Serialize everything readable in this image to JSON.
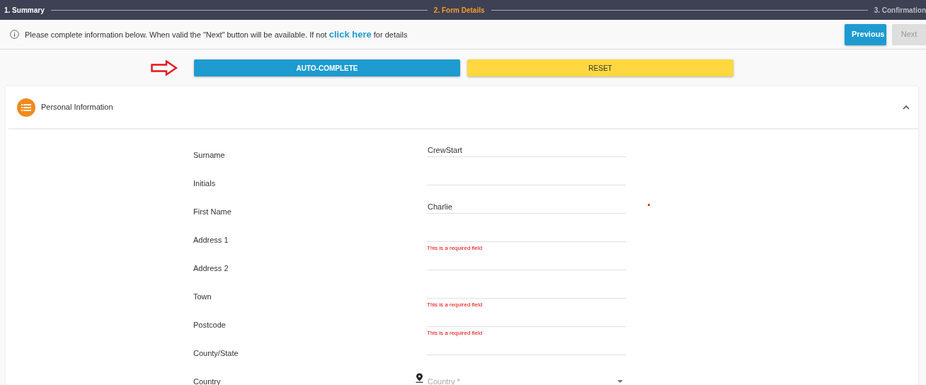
{
  "stepper": [
    {
      "label": "1. Summary",
      "selected": false,
      "completed": true
    },
    {
      "label": "2. Form Details",
      "selected": true
    },
    {
      "label": "3. Confirmation",
      "selected": false,
      "completed": false
    }
  ],
  "info_bar": {
    "message": "Please complete information below. When valid the \"Next\" button will be available. If not",
    "link": "click here",
    "message_end": "for details"
  },
  "nav_buttons": [
    {
      "label": "Previous",
      "disabled": false
    },
    {
      "label": "Next",
      "disabled": true
    }
  ],
  "actions": [
    {
      "label": "AUTO-COMPLETE",
      "kind": "primary"
    },
    {
      "label": "RESET",
      "kind": "warning"
    }
  ],
  "section": {
    "title": "Personal Information",
    "expanded": true,
    "fields": [
      {
        "label": "Surname",
        "kind": "text",
        "value": "CrewStart",
        "required": false
      },
      {
        "label": "Initials",
        "kind": "text",
        "required": false
      },
      {
        "label": "First Name",
        "kind": "text",
        "value": "Charlie",
        "required": true
      },
      {
        "label": "Address 1",
        "kind": "text",
        "error": "This is a required field",
        "required": false
      },
      {
        "label": "Address 2",
        "kind": "text",
        "required": false
      },
      {
        "label": "Town",
        "kind": "text",
        "error": "This is a required field",
        "required": false
      },
      {
        "label": "Postcode",
        "kind": "text",
        "error": "This is a required field",
        "required": false
      },
      {
        "label": "County/State",
        "kind": "text",
        "required": false
      },
      {
        "label": "Country",
        "kind": "select",
        "placeholder": "Country *",
        "required": false
      }
    ]
  }
}
